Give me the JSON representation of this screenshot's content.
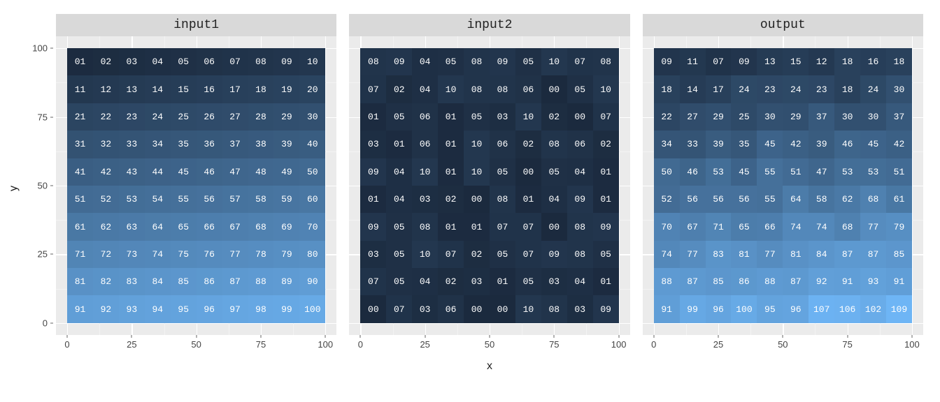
{
  "chart_data": [
    {
      "type": "heatmap",
      "facet_label": "input1",
      "xlabel": "x",
      "ylabel": "y",
      "x_ticks": [
        0,
        25,
        50,
        75,
        100
      ],
      "y_ticks": [
        0,
        25,
        50,
        75,
        100
      ],
      "xlim": [
        0,
        100
      ],
      "ylim": [
        0,
        100
      ],
      "color_scale": {
        "low": "#1b2a3e",
        "high": "#6eb5f5"
      },
      "rows": [
        [
          1,
          2,
          3,
          4,
          5,
          6,
          7,
          8,
          9,
          10
        ],
        [
          11,
          12,
          13,
          14,
          15,
          16,
          17,
          18,
          19,
          20
        ],
        [
          21,
          22,
          23,
          24,
          25,
          26,
          27,
          28,
          29,
          30
        ],
        [
          31,
          32,
          33,
          34,
          35,
          36,
          37,
          38,
          39,
          40
        ],
        [
          41,
          42,
          43,
          44,
          45,
          46,
          47,
          48,
          49,
          50
        ],
        [
          51,
          52,
          53,
          54,
          55,
          56,
          57,
          58,
          59,
          60
        ],
        [
          61,
          62,
          63,
          64,
          65,
          66,
          67,
          68,
          69,
          70
        ],
        [
          71,
          72,
          73,
          74,
          75,
          76,
          77,
          78,
          79,
          80
        ],
        [
          81,
          82,
          83,
          84,
          85,
          86,
          87,
          88,
          89,
          90
        ],
        [
          91,
          92,
          93,
          94,
          95,
          96,
          97,
          98,
          99,
          100
        ]
      ]
    },
    {
      "type": "heatmap",
      "facet_label": "input2",
      "xlabel": "x",
      "ylabel": "y",
      "x_ticks": [
        0,
        25,
        50,
        75,
        100
      ],
      "y_ticks": [
        0,
        25,
        50,
        75,
        100
      ],
      "xlim": [
        0,
        100
      ],
      "ylim": [
        0,
        100
      ],
      "color_scale": {
        "low": "#1b2a3e",
        "high": "#6eb5f5"
      },
      "rows": [
        [
          8,
          9,
          4,
          5,
          8,
          9,
          5,
          10,
          7,
          8
        ],
        [
          7,
          2,
          4,
          10,
          8,
          8,
          6,
          0,
          5,
          10
        ],
        [
          1,
          5,
          6,
          1,
          5,
          3,
          10,
          2,
          0,
          7
        ],
        [
          3,
          1,
          6,
          1,
          10,
          6,
          2,
          8,
          6,
          2
        ],
        [
          9,
          4,
          10,
          1,
          10,
          5,
          0,
          5,
          4,
          1
        ],
        [
          1,
          4,
          3,
          2,
          0,
          8,
          1,
          4,
          9,
          1
        ],
        [
          9,
          5,
          8,
          1,
          1,
          7,
          7,
          0,
          8,
          9
        ],
        [
          3,
          5,
          10,
          7,
          2,
          5,
          7,
          9,
          8,
          5
        ],
        [
          7,
          5,
          4,
          2,
          3,
          1,
          5,
          3,
          4,
          1
        ],
        [
          0,
          7,
          3,
          6,
          0,
          0,
          10,
          8,
          3,
          9
        ]
      ]
    },
    {
      "type": "heatmap",
      "facet_label": "output",
      "xlabel": "x",
      "ylabel": "y",
      "x_ticks": [
        0,
        25,
        50,
        75,
        100
      ],
      "y_ticks": [
        0,
        25,
        50,
        75,
        100
      ],
      "xlim": [
        0,
        100
      ],
      "ylim": [
        0,
        100
      ],
      "color_scale": {
        "low": "#1b2a3e",
        "high": "#6eb5f5"
      },
      "rows": [
        [
          9,
          11,
          7,
          9,
          13,
          15,
          12,
          18,
          16,
          18
        ],
        [
          18,
          14,
          17,
          24,
          23,
          24,
          23,
          18,
          24,
          30
        ],
        [
          22,
          27,
          29,
          25,
          30,
          29,
          37,
          30,
          30,
          37
        ],
        [
          34,
          33,
          39,
          35,
          45,
          42,
          39,
          46,
          45,
          42
        ],
        [
          50,
          46,
          53,
          45,
          55,
          51,
          47,
          53,
          53,
          51
        ],
        [
          52,
          56,
          56,
          56,
          55,
          64,
          58,
          62,
          68,
          61
        ],
        [
          70,
          67,
          71,
          65,
          66,
          74,
          74,
          68,
          77,
          79
        ],
        [
          74,
          77,
          83,
          81,
          77,
          81,
          84,
          87,
          87,
          85
        ],
        [
          88,
          87,
          85,
          86,
          88,
          87,
          92,
          91,
          93,
          91
        ],
        [
          91,
          99,
          96,
          100,
          95,
          96,
          107,
          106,
          102,
          109
        ]
      ]
    }
  ],
  "global_value_range": [
    0,
    109
  ],
  "axis": {
    "xlabel": "x",
    "ylabel": "y"
  }
}
